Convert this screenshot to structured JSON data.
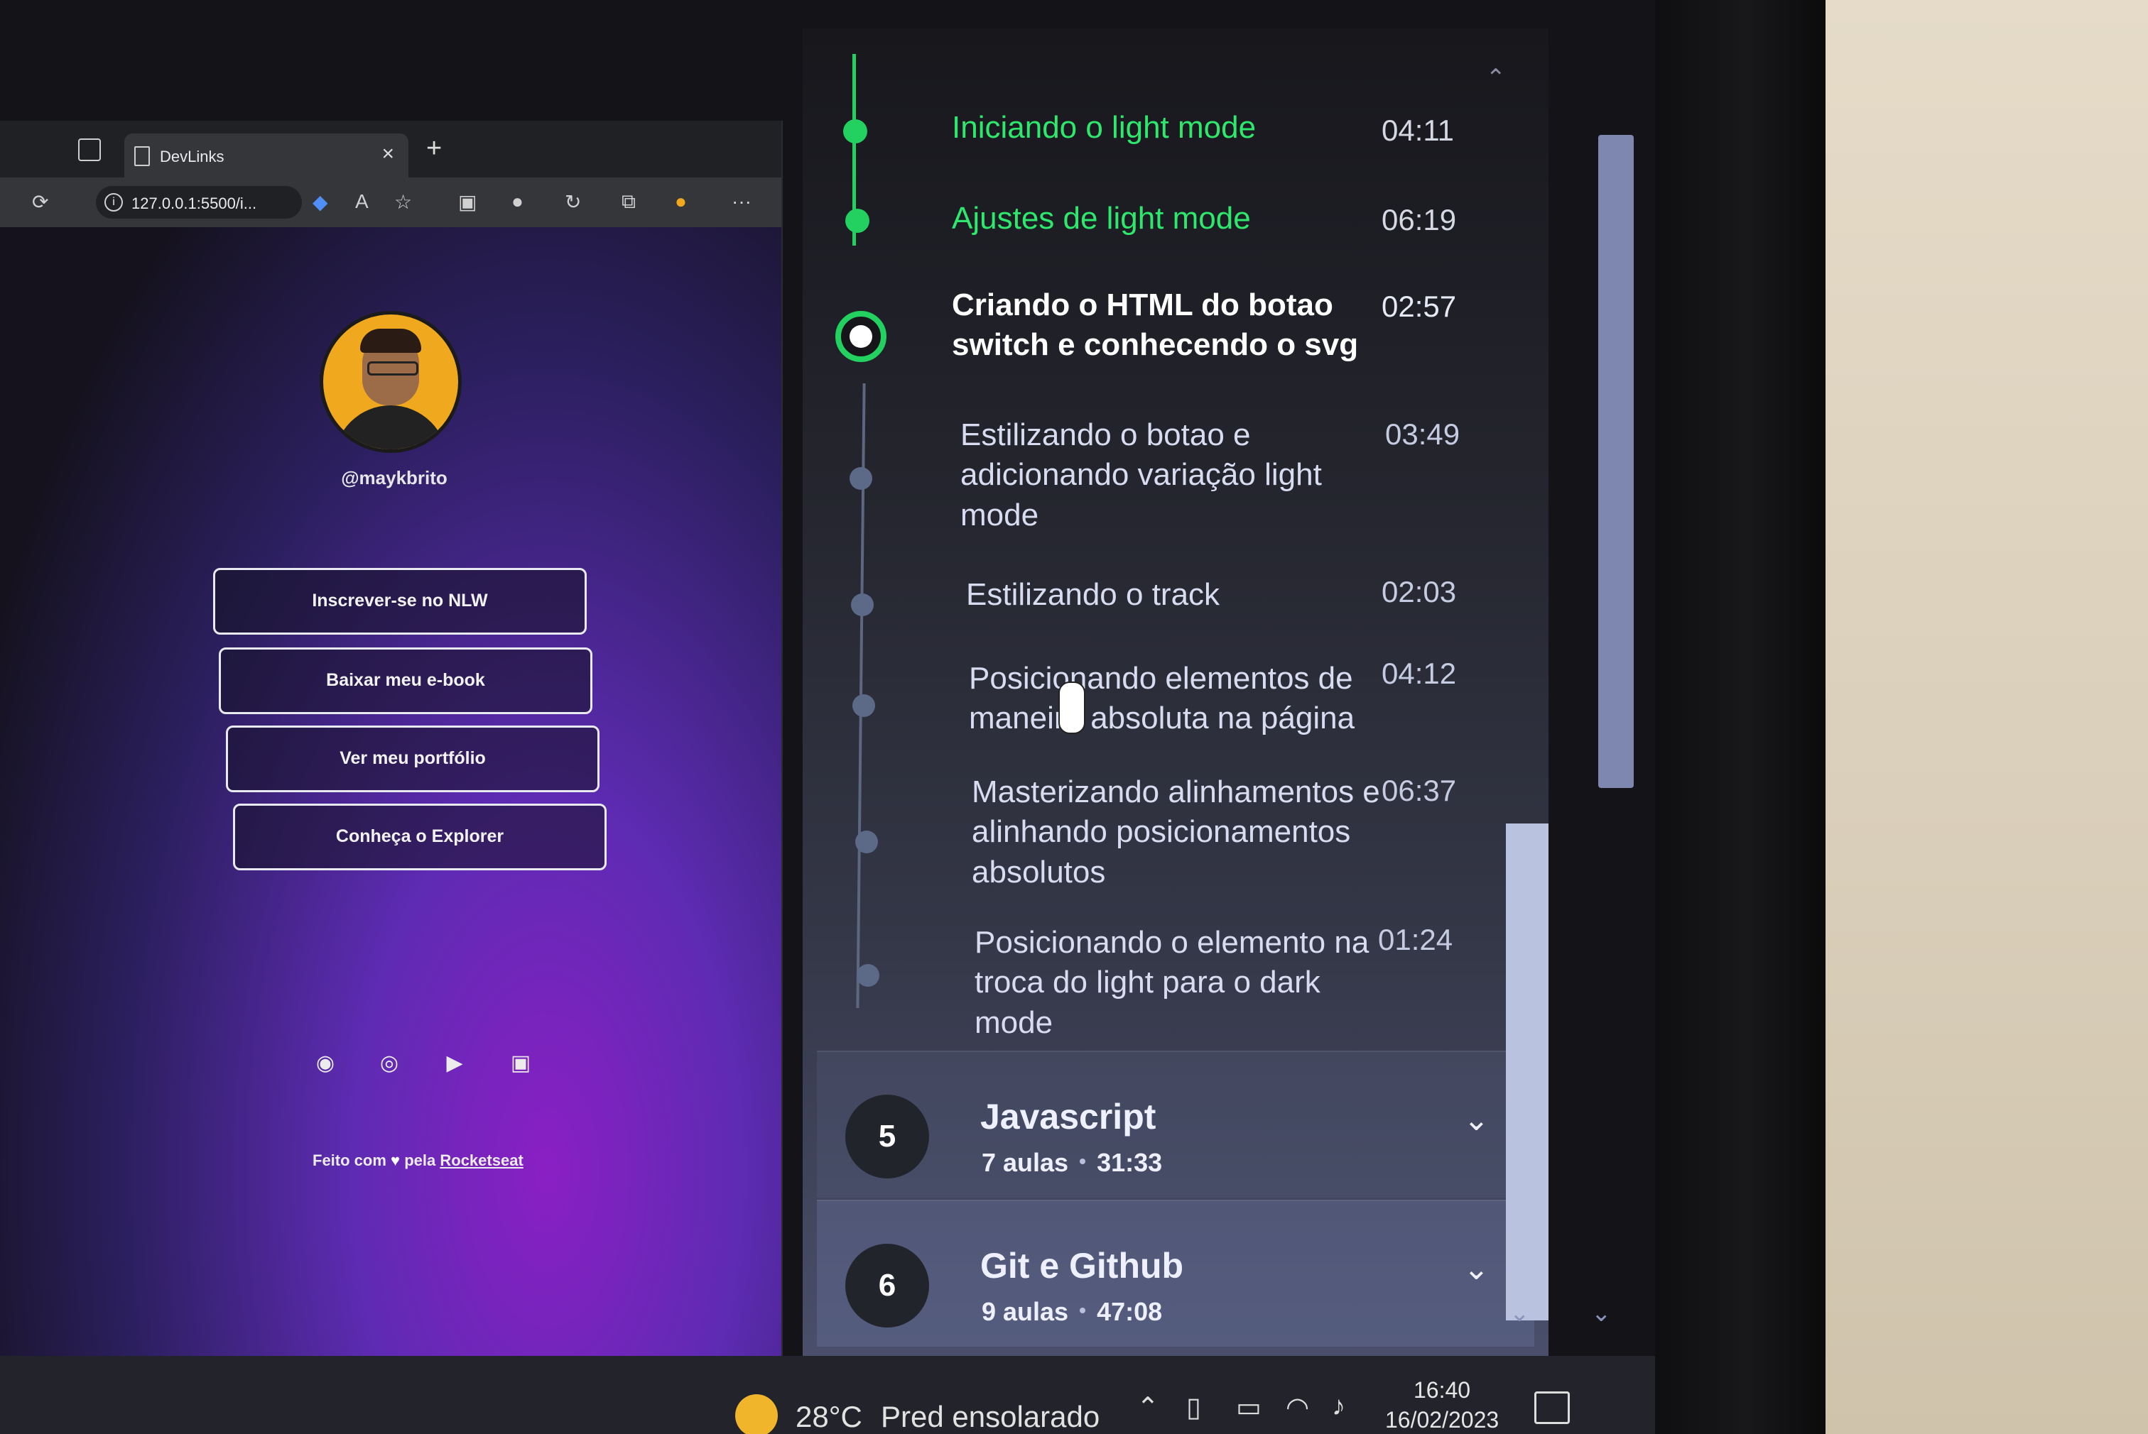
{
  "browser": {
    "tab_title": "DevLinks",
    "tab_close": "×",
    "new_tab": "+",
    "url": "127.0.0.1:5500/i...",
    "toolbar_more": "···"
  },
  "profile": {
    "username": "@maykbrito",
    "links": [
      "Inscrever-se no NLW",
      "Baixar meu e-book",
      "Ver meu portfólio",
      "Conheça o Explorer"
    ],
    "footer_prefix": "Feito com",
    "footer_middle": "pela",
    "footer_brand": "Rocketseat"
  },
  "lessons": [
    {
      "title": "Iniciando o light mode",
      "duration": "04:11",
      "status": "done"
    },
    {
      "title": "Ajustes de light mode",
      "duration": "06:19",
      "status": "done"
    },
    {
      "title": "Criando o HTML do botao switch e conhecendo o svg",
      "duration": "02:57",
      "status": "current"
    },
    {
      "title": "Estilizando o botao e adicionando variação light mode",
      "duration": "03:49",
      "status": "pending"
    },
    {
      "title": "Estilizando o track",
      "duration": "02:03",
      "status": "pending"
    },
    {
      "title": "Posicionando elementos de maneira absoluta na página",
      "duration": "04:12",
      "status": "pending"
    },
    {
      "title": "Masterizando alinhamentos e alinhando posicionamentos absolutos",
      "duration": "06:37",
      "status": "pending"
    },
    {
      "title": "Posicionando o elemento na troca do light para o dark mode",
      "duration": "01:24",
      "status": "pending"
    }
  ],
  "modules": [
    {
      "number": "5",
      "title": "Javascript",
      "lessons": "7 aulas",
      "duration": "31:33"
    },
    {
      "number": "6",
      "title": "Git e Github",
      "lessons": "9 aulas",
      "duration": "47:08"
    }
  ],
  "taskbar": {
    "temperature": "28°C",
    "weather": "Pred ensolarado",
    "time": "16:40",
    "date": "16/02/2023"
  },
  "colors": {
    "accent_green": "#22d160",
    "panel_bg": "#25262f",
    "browser_purple": "#8a1fc4"
  }
}
